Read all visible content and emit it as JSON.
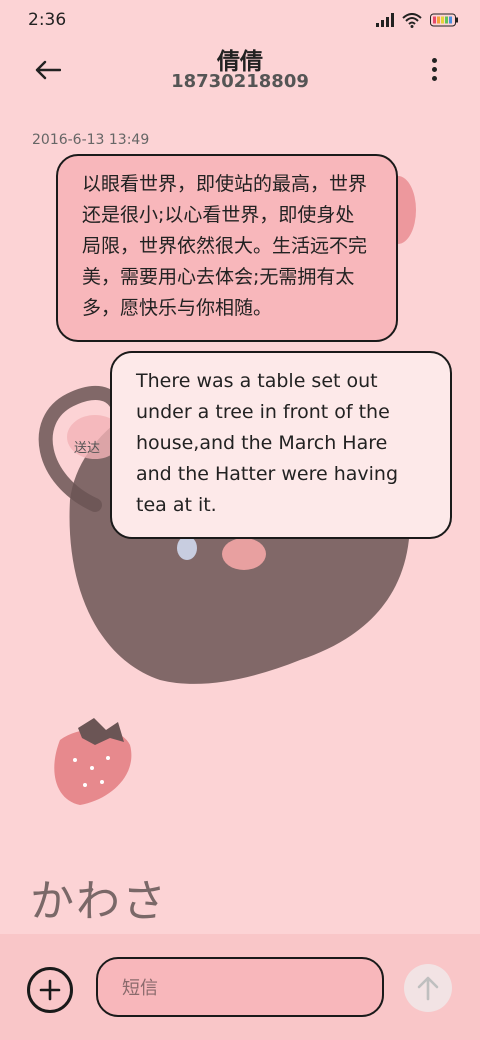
{
  "status_bar": {
    "time": "2:36"
  },
  "header": {
    "contact_name": "倩倩",
    "contact_number": "18730218809"
  },
  "conversation": {
    "timestamp": "2016-6-13 13:49",
    "messages": [
      {
        "text": "以眼看世界，即使站的最高，世界还是很小;以心看世界，即使身处局限，世界依然很大。生活远不完美，需要用心去体会;无需拥有太多，愿快乐与你相随。"
      },
      {
        "text": "There was a table set out under a tree in front of the house,and the March Hare and the Hatter were having tea at it."
      }
    ],
    "delivery_status": "送达"
  },
  "compose": {
    "placeholder": "短信"
  },
  "wallpaper": {
    "text": "かわさ"
  },
  "colors": {
    "background": "#fcd3d5",
    "bubble_pink": "#f8b7bb",
    "bubble_white": "#fde9e9",
    "input_bar": "#f9c6c8"
  }
}
